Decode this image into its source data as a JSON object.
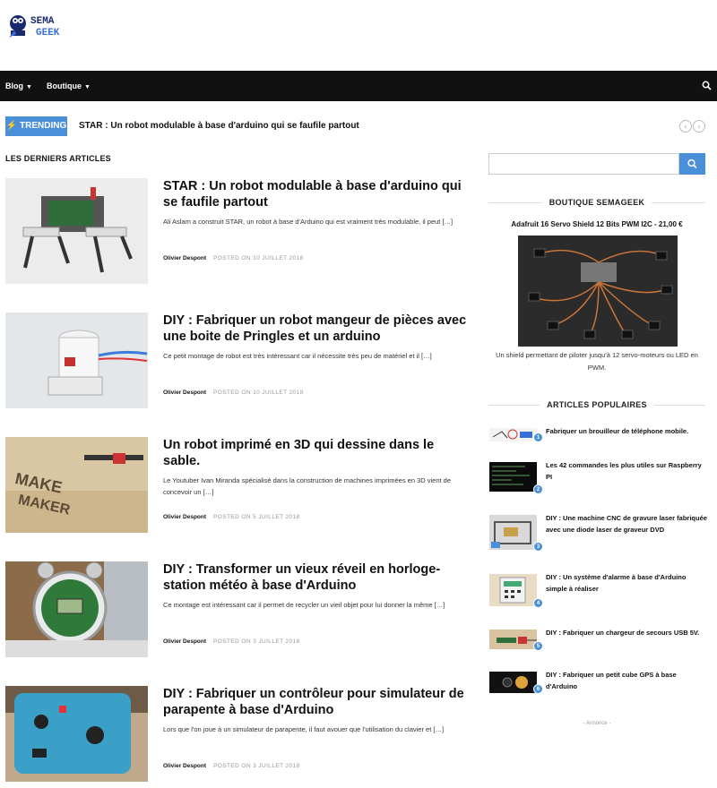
{
  "header": {
    "logo_alt": "SEMAGEEK"
  },
  "nav": {
    "items": [
      {
        "label": "Blog"
      },
      {
        "label": "Boutique"
      }
    ]
  },
  "trending": {
    "badge": "TRENDING",
    "text": "STAR : Un robot modulable à base d'arduino qui se faufile partout",
    "prev": "‹",
    "next": "›"
  },
  "latest": {
    "heading": "LES DERNIERS ARTICLES",
    "articles": [
      {
        "title": "STAR : Un robot modulable à base d'arduino qui se faufile partout",
        "excerpt": "Ali Aslam a construit STAR, un robot à base d'Arduino qui est vraiment très modulable, il peut […]",
        "author": "Olivier Despont",
        "date": "POSTED ON 10 JUILLET 2018"
      },
      {
        "title": "DIY : Fabriquer un robot mangeur de pièces avec une boite de Pringles et un arduino",
        "excerpt": "Ce petit montage de robot est très intéressant car il nécessite très peu de matériel et il […]",
        "author": "Olivier Despont",
        "date": "POSTED ON 10 JUILLET 2018"
      },
      {
        "title": "Un robot imprimé en 3D qui dessine dans le sable.",
        "excerpt": "Le Youtuber Ivan Miranda spécialisé dans la construction de machines imprimées en 3D vient de concevoir un […]",
        "author": "Olivier Despont",
        "date": "POSTED ON 5 JUILLET 2018"
      },
      {
        "title": "DIY : Transformer un vieux réveil en horloge-station météo à base d'Arduino",
        "excerpt": "Ce montage est intéressant car il permet de recycler un vieil objet pour lui donner la même […]",
        "author": "Olivier Despont",
        "date": "POSTED ON 3 JUILLET 2018"
      },
      {
        "title": "DIY : Fabriquer un contrôleur pour simulateur de parapente à base d'Arduino",
        "excerpt": "Lors que l'on joue à un simulateur de parapente, il faut avouer que l'utilisation du clavier et […]",
        "author": "Olivier Despont",
        "date": "POSTED ON 3 JUILLET 2018"
      }
    ]
  },
  "sidebar": {
    "search_placeholder": "",
    "shop_heading": "BOUTIQUE SEMAGEEK",
    "product_title": "Adafruit 16 Servo Shield 12 Bits PWM I2C - 21,00 €",
    "product_desc": "Un shield permettant de piloter jusqu'à 12 servo-moteurs ou LED en PWM.",
    "popular_heading": "ARTICLES POPULAIRES",
    "popular": [
      {
        "rank": "1",
        "title": "Fabriquer un brouilleur de téléphone mobile."
      },
      {
        "rank": "2",
        "title": "Les 42 commandes les plus utiles sur Raspberry PI"
      },
      {
        "rank": "3",
        "title": "DIY : Une machine CNC de gravure laser fabriquée avec une diode laser de graveur DVD"
      },
      {
        "rank": "4",
        "title": "DIY : Un système d'alarme à base d'Arduino simple à réaliser"
      },
      {
        "rank": "5",
        "title": "DIY : Fabriquer un chargeur de secours USB 5V."
      },
      {
        "rank": "6",
        "title": "DIY : Fabriquer un petit cube GPS à base d'Arduino"
      }
    ],
    "ad_label": "- Annonce -"
  },
  "colors": {
    "accent": "#4a90d9",
    "navbar": "#111111"
  }
}
